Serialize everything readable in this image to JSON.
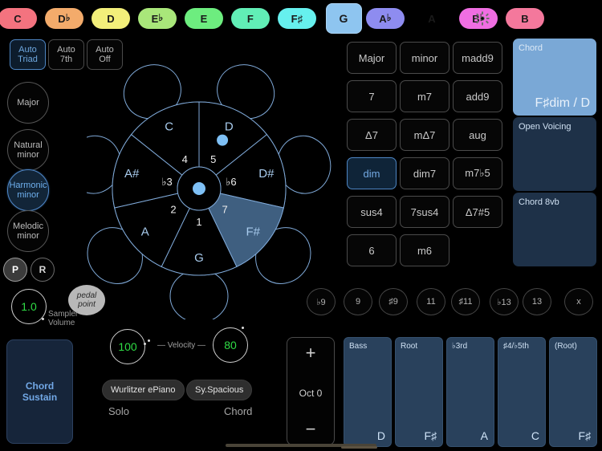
{
  "keybar": {
    "keys": [
      {
        "label": "C",
        "flat": "",
        "color": "#f4737f",
        "selected": false
      },
      {
        "label": "D",
        "flat": "♭",
        "color": "#f3ab6b",
        "selected": false
      },
      {
        "label": "D",
        "flat": "",
        "color": "#f3ef7a",
        "selected": false
      },
      {
        "label": "E",
        "flat": "♭",
        "color": "#a9e77a",
        "selected": false
      },
      {
        "label": "E",
        "flat": "",
        "color": "#6ded7f",
        "selected": false
      },
      {
        "label": "F",
        "flat": "",
        "color": "#61eeb6",
        "selected": false
      },
      {
        "label": "F♯",
        "flat": "",
        "color": "#66f0ee",
        "selected": false
      },
      {
        "label": "G",
        "flat": "",
        "color": "#8ec5f0",
        "selected": true
      },
      {
        "label": "A",
        "flat": "♭",
        "color": "#8e8cf0",
        "selected": false
      },
      {
        "label": "A",
        "flat": "",
        "color": "#c municipal",
        "selected": false
      },
      {
        "label": "B",
        "flat": "♭",
        "color": "#f06ee2",
        "selected": false
      },
      {
        "label": "B",
        "flat": "",
        "color": "#f4789c",
        "selected": false
      }
    ],
    "settings_icon": "gear-icon"
  },
  "auto_buttons": [
    {
      "line1": "Auto",
      "line2": "Triad",
      "on": true
    },
    {
      "line1": "Auto",
      "line2": "7th",
      "on": false
    },
    {
      "line1": "Auto",
      "line2": "Off",
      "on": false
    }
  ],
  "scales": [
    {
      "line1": "Major",
      "line2": "",
      "on": false
    },
    {
      "line1": "Natural",
      "line2": "minor",
      "on": false
    },
    {
      "line1": "Harmonic",
      "line2": "minor",
      "on": true
    },
    {
      "line1": "Melodic",
      "line2": "minor",
      "on": false
    }
  ],
  "pr_buttons": [
    {
      "label": "P",
      "on": true
    },
    {
      "label": "R",
      "on": false
    }
  ],
  "pedal_point": {
    "line1": "pedal",
    "line2": "point"
  },
  "sampler_volume": {
    "value": "1.0",
    "label_line1": "Sampler",
    "label_line2": "Volume"
  },
  "chord_sustain": {
    "line1": "Chord",
    "line2": "Sustain"
  },
  "wheel": {
    "outer_labels": [
      "C",
      "D",
      "D#",
      "F#",
      "G",
      "A",
      "A#"
    ],
    "degree_labels": [
      "4",
      "5",
      "♭6",
      "7",
      "1",
      "2",
      "♭3"
    ],
    "selected_segment": "F#",
    "marker_segment": "D",
    "stroke": "#7fa9d8",
    "selected_fill": "#3f5f80"
  },
  "chord_types": [
    {
      "label": "Major",
      "on": false
    },
    {
      "label": "minor",
      "on": false
    },
    {
      "label": "madd9",
      "on": false
    },
    {
      "label": "7",
      "on": false
    },
    {
      "label": "m7",
      "on": false
    },
    {
      "label": "add9",
      "on": false
    },
    {
      "label": "Δ7",
      "on": false
    },
    {
      "label": "mΔ7",
      "on": false
    },
    {
      "label": "aug",
      "on": false
    },
    {
      "label": "dim",
      "on": true
    },
    {
      "label": "dim7",
      "on": false
    },
    {
      "label": "m7♭5",
      "on": false
    },
    {
      "label": "sus4",
      "on": false
    },
    {
      "label": "7sus4",
      "on": false
    },
    {
      "label": "Δ7#5",
      "on": false
    },
    {
      "label": "6",
      "on": false
    },
    {
      "label": "m6",
      "on": false
    }
  ],
  "extensions": [
    {
      "label": "♭9"
    },
    {
      "label": "9"
    },
    {
      "label": "♯9"
    },
    {
      "label": "11"
    },
    {
      "label": "♯11"
    },
    {
      "label": "♭13"
    },
    {
      "label": "13"
    },
    {
      "label": "x"
    }
  ],
  "right_panels": [
    {
      "header": "Chord",
      "value": "F♯dim / D"
    },
    {
      "header": "Open Voicing",
      "value": ""
    },
    {
      "header": "Chord 8vb",
      "value": ""
    }
  ],
  "velocity": {
    "solo_value": "100",
    "chord_value": "80",
    "label": "—  Velocity  —"
  },
  "instruments": {
    "solo": {
      "name": "Wurlitzer ePiano",
      "caption": "Solo"
    },
    "chord": {
      "name": "Sy.Spacious",
      "caption": "Chord"
    }
  },
  "octave": {
    "plus": "+",
    "label": "Oct 0",
    "minus": "−"
  },
  "note_columns": [
    {
      "label": "Bass",
      "note": "D"
    },
    {
      "label": "Root",
      "note": "F♯"
    },
    {
      "label": "♭3rd",
      "note": "A"
    },
    {
      "label": "♯4/♭5th",
      "note": "C"
    },
    {
      "label": "(Root)",
      "note": "F♯"
    }
  ]
}
